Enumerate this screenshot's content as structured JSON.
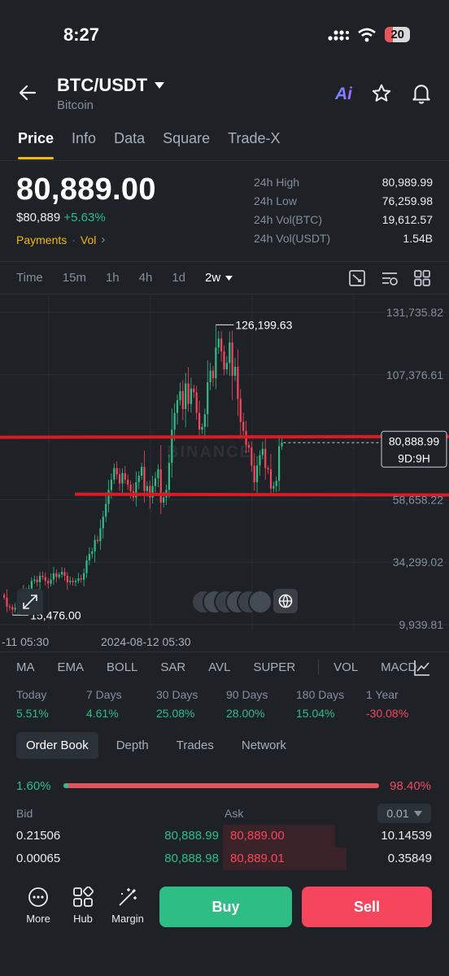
{
  "status": {
    "time": "8:27",
    "battery": "20"
  },
  "header": {
    "pair": "BTC/USDT",
    "subtitle": "Bitcoin",
    "ai_label": "Ai"
  },
  "tabs": [
    "Price",
    "Info",
    "Data",
    "Square",
    "Trade-X"
  ],
  "price": {
    "last": "80,889.00",
    "usd": "$80,889",
    "change": "+5.63%",
    "payments": "Payments",
    "vol": "Vol"
  },
  "stats": [
    {
      "label": "24h High",
      "value": "80,989.99"
    },
    {
      "label": "24h Low",
      "value": "76,259.98"
    },
    {
      "label": "24h Vol(BTC)",
      "value": "19,612.57"
    },
    {
      "label": "24h Vol(USDT)",
      "value": "1.54B"
    }
  ],
  "intervals": {
    "items": [
      "Time",
      "15m",
      "1h",
      "4h",
      "1d"
    ],
    "selected": "2w"
  },
  "chart_data": {
    "type": "candlestick",
    "y_axis_labels": [
      "131,735.82",
      "107,376.61",
      "83,017.41",
      "58,658.22",
      "34,299.02",
      "9,939.81"
    ],
    "x_axis_labels": [
      "-11 05:30",
      "2024-08-12 05:30"
    ],
    "high_marker": "126,199.63",
    "low_marker": "15,476.00",
    "last_price_tag": "80,888.99",
    "countdown": "9D:9H",
    "watermark": "BINANCE",
    "ylim": [
      9939.81,
      131735.82
    ],
    "closes": [
      20500,
      17000,
      16800,
      15800,
      16500,
      19000,
      21500,
      23000,
      22500,
      24000,
      27000,
      27500,
      26500,
      29000,
      28500,
      27000,
      26000,
      27500,
      30000,
      28500,
      29500,
      30500,
      29000,
      26500,
      27000,
      26500,
      27000,
      28000,
      27500,
      30000,
      35000,
      37500,
      38500,
      43000,
      42500,
      47500,
      52000,
      57000,
      62500,
      66500,
      71000,
      68500,
      65000,
      69000,
      66500,
      64500,
      62000,
      59500,
      65500,
      68000,
      71500,
      62000,
      64000,
      59500,
      64000,
      67000,
      70500,
      57500,
      59500,
      62500,
      73000,
      86000,
      92500,
      97500,
      101000,
      94000,
      104000,
      96000,
      102000,
      100500,
      92500,
      86000,
      87000,
      92000,
      104500,
      109000,
      106000,
      118000,
      121500,
      116500,
      109500,
      112000,
      120000,
      107000,
      110500,
      98000,
      89000,
      85500,
      80000,
      79000,
      72000,
      65500,
      72000,
      76000,
      78500,
      71000,
      70500,
      63000,
      64000,
      66000,
      79500,
      80889
    ],
    "annotation_lines": [
      83000,
      60800
    ]
  },
  "indicators": [
    "MA",
    "EMA",
    "BOLL",
    "SAR",
    "AVL",
    "SUPER",
    "VOL",
    "MACD"
  ],
  "performance": [
    {
      "label": "Today",
      "value": "5.51%",
      "dir": "up"
    },
    {
      "label": "7 Days",
      "value": "4.61%",
      "dir": "up"
    },
    {
      "label": "30 Days",
      "value": "25.08%",
      "dir": "up"
    },
    {
      "label": "90 Days",
      "value": "28.00%",
      "dir": "up"
    },
    {
      "label": "180 Days",
      "value": "15.04%",
      "dir": "up"
    },
    {
      "label": "1 Year",
      "value": "-30.08%",
      "dir": "down"
    }
  ],
  "order_tabs": [
    "Order Book",
    "Depth",
    "Trades",
    "Network"
  ],
  "ratio": {
    "buy": "1.60%",
    "sell": "98.40%",
    "buy_fraction": 0.016
  },
  "orderbook": {
    "bid_label": "Bid",
    "ask_label": "Ask",
    "precision": "0.01",
    "rows": [
      {
        "bid_qty": "0.21506",
        "bid_price": "80,888.99",
        "ask_price": "80,889.00",
        "ask_qty": "10.14539",
        "ask_depth": 0.86
      },
      {
        "bid_qty": "0.00065",
        "bid_price": "80,888.98",
        "ask_price": "80,889.01",
        "ask_qty": "0.35849",
        "ask_depth": 0.95
      }
    ]
  },
  "bottom_nav": {
    "more": "More",
    "hub": "Hub",
    "margin": "Margin",
    "buy": "Buy",
    "sell": "Sell"
  }
}
